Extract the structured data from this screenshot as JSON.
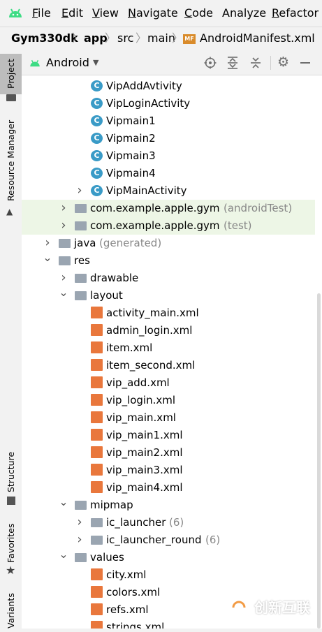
{
  "menubar": {
    "items": [
      {
        "mnemonic": "F",
        "rest": "ile"
      },
      {
        "mnemonic": "E",
        "rest": "dit"
      },
      {
        "mnemonic": "V",
        "rest": "iew"
      },
      {
        "mnemonic": "N",
        "rest": "avigate"
      },
      {
        "mnemonic": "C",
        "rest": "ode"
      },
      {
        "mnemonic": "",
        "rest": "Analyze"
      },
      {
        "mnemonic": "R",
        "rest": "efactor"
      }
    ]
  },
  "breadcrumb": {
    "items": [
      "Gym330dk",
      "app",
      "src",
      "main",
      "AndroidManifest.xml"
    ],
    "manifest_badge": "MF"
  },
  "sidebar": {
    "tabs": [
      "Project",
      "Resource Manager",
      "Structure",
      "Favorites",
      "Variants"
    ]
  },
  "toolwindow": {
    "view_selector": "Android",
    "icons": [
      "target-icon",
      "expand-all-icon",
      "collapse-all-icon",
      "settings-icon",
      "minimize-icon"
    ]
  },
  "tree": [
    {
      "label": "VipAddAvtivity",
      "kind": "class"
    },
    {
      "label": "VipLoginActivity",
      "kind": "class"
    },
    {
      "label": "Vipmain1",
      "kind": "class"
    },
    {
      "label": "Vipmain2",
      "kind": "class"
    },
    {
      "label": "Vipmain3",
      "kind": "class"
    },
    {
      "label": "Vipmain4",
      "kind": "class"
    },
    {
      "label": "VipMainActivity",
      "kind": "class",
      "expandable": true
    },
    {
      "label": "com.example.apple.gym",
      "suffix": "(androidTest)",
      "kind": "package",
      "expandable": true
    },
    {
      "label": "com.example.apple.gym",
      "suffix": "(test)",
      "kind": "package",
      "expandable": true
    },
    {
      "label": "java",
      "suffix": "(generated)",
      "kind": "folder",
      "expandable": true
    },
    {
      "label": "res",
      "kind": "folder",
      "expanded": true
    },
    {
      "label": "drawable",
      "kind": "folder",
      "expandable": true
    },
    {
      "label": "layout",
      "kind": "folder",
      "expanded": true
    },
    {
      "label": "activity_main.xml",
      "kind": "xml"
    },
    {
      "label": "admin_login.xml",
      "kind": "xml"
    },
    {
      "label": "item.xml",
      "kind": "xml"
    },
    {
      "label": "item_second.xml",
      "kind": "xml"
    },
    {
      "label": "vip_add.xml",
      "kind": "xml"
    },
    {
      "label": "vip_login.xml",
      "kind": "xml"
    },
    {
      "label": "vip_main.xml",
      "kind": "xml"
    },
    {
      "label": "vip_main1.xml",
      "kind": "xml"
    },
    {
      "label": "vip_main2.xml",
      "kind": "xml"
    },
    {
      "label": "vip_main3.xml",
      "kind": "xml"
    },
    {
      "label": "vip_main4.xml",
      "kind": "xml"
    },
    {
      "label": "mipmap",
      "kind": "folder",
      "expanded": true
    },
    {
      "label": "ic_launcher",
      "suffix": "(6)",
      "kind": "folder",
      "expandable": true
    },
    {
      "label": "ic_launcher_round",
      "suffix": "(6)",
      "kind": "folder",
      "expandable": true
    },
    {
      "label": "values",
      "kind": "folder",
      "expanded": true
    },
    {
      "label": "city.xml",
      "kind": "xml"
    },
    {
      "label": "colors.xml",
      "kind": "xml"
    },
    {
      "label": "refs.xml",
      "kind": "xml"
    },
    {
      "label": "strings.xml",
      "kind": "xml"
    }
  ],
  "watermark": {
    "text": "创新互联"
  },
  "colors": {
    "class_icon": "#3a9bc7",
    "xml_icon": "#e9773c",
    "folder_icon": "#9aa5b1",
    "highlight": "#edf6e6"
  }
}
